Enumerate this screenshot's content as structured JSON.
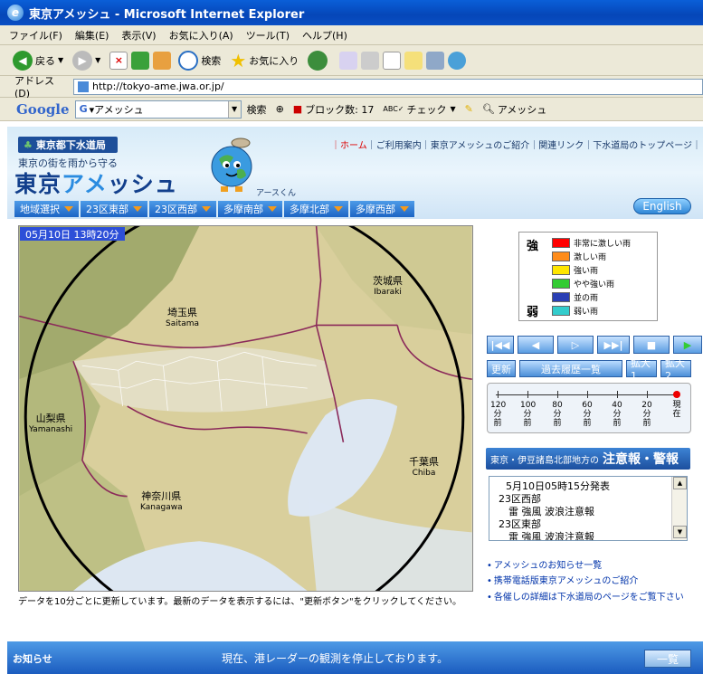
{
  "window": {
    "title": "東京アメッシュ - Microsoft Internet Explorer"
  },
  "menu": [
    "ファイル(F)",
    "編集(E)",
    "表示(V)",
    "お気に入り(A)",
    "ツール(T)",
    "ヘルプ(H)"
  ],
  "toolbar": {
    "back": "戻る",
    "search": "検索",
    "favorites": "お気に入り"
  },
  "address": {
    "label": "アドレス(D)",
    "url": "http://tokyo-ame.jwa.or.jp/"
  },
  "google": {
    "logo": "Google",
    "query": "▾アメッシュ",
    "search": "検索",
    "block": "ブロック数: 17",
    "check": "チェック",
    "amesh": "アメッシュ"
  },
  "header": {
    "bureau": "東京都下水道局",
    "tagline": "東京の街を雨から守る",
    "logo_a": "東京",
    "logo_b": "アメ",
    "logo_c": "ッシュ",
    "mascot_name": "アースくん",
    "english": "English",
    "links": [
      "｜ホーム",
      "｜ご利用案内",
      "｜東京アメッシュのご紹介",
      "｜関連リンク",
      "｜下水道局のトップページ｜"
    ],
    "regions": [
      "地域選択",
      "23区東部",
      "23区西部",
      "多摩南部",
      "多摩北部",
      "多摩西部"
    ]
  },
  "map": {
    "timestamp": "05月10日 13時20分",
    "labels": {
      "saitama_jp": "埼玉県",
      "saitama_en": "Saitama",
      "ibaraki_jp": "茨城県",
      "ibaraki_en": "Ibaraki",
      "yamanashi_jp": "山梨県",
      "yamanashi_en": "Yamanashi",
      "chiba_jp": "千葉県",
      "chiba_en": "Chiba",
      "kanagawa_jp": "神奈川県",
      "kanagawa_en": "Kanagawa"
    },
    "note": "データを10分ごとに更新しています。最新のデータを表示するには、\"更新ボタン\"をクリックしてください。"
  },
  "legend": {
    "strong": "強",
    "weak": "弱",
    "items": [
      {
        "label": "非常に激しい雨",
        "color": "#ff0000"
      },
      {
        "label": "激しい雨",
        "color": "#ff8c1a"
      },
      {
        "label": "強い雨",
        "color": "#ffe600"
      },
      {
        "label": "やや強い雨",
        "color": "#33cc33"
      },
      {
        "label": "並の雨",
        "color": "#2a3fb4"
      },
      {
        "label": "弱い雨",
        "color": "#33cccc"
      }
    ]
  },
  "controls": {
    "refresh": "更新",
    "history": "過去履歴一覧",
    "zoom1": "拡大1",
    "zoom2": "拡大2"
  },
  "timeline": {
    "labels": [
      [
        "120",
        "分",
        "前"
      ],
      [
        "100",
        "分",
        "前"
      ],
      [
        "80",
        "分",
        "前"
      ],
      [
        "60",
        "分",
        "前"
      ],
      [
        "40",
        "分",
        "前"
      ],
      [
        "20",
        "分",
        "前"
      ],
      [
        "現",
        "在",
        ""
      ]
    ]
  },
  "warnings": {
    "header_small": "東京・伊豆諸島北部地方の",
    "header_big": "注意報・警報",
    "lines": [
      "5月10日05時15分発表",
      "23区西部",
      "　雷 強風 波浪注意報",
      "23区東部",
      "　雷 強風 波浪注意報"
    ]
  },
  "links": [
    "アメッシュのお知らせ一覧",
    "携帯電話版東京アメッシュのご紹介",
    "各催しの詳細は下水道局のページをご覧下さい"
  ],
  "footer": {
    "label": "お知らせ",
    "text": "現在、港レーダーの観測を停止しております。",
    "button": "一覧"
  }
}
